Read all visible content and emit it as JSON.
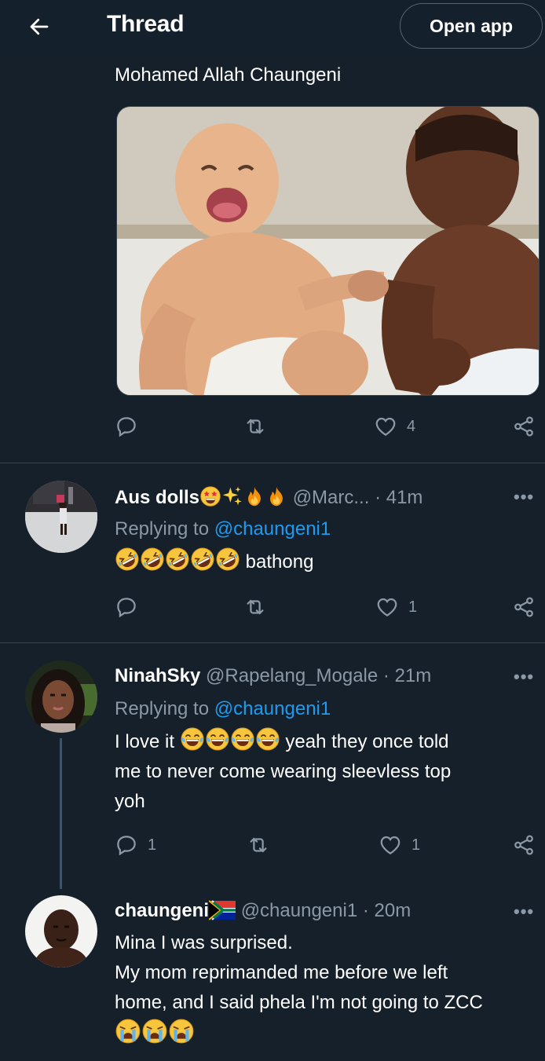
{
  "header": {
    "title": "Thread",
    "open_app_label": "Open app"
  },
  "main_tweet": {
    "author_display": "Mohamed Allah Chaungeni",
    "actions": {
      "reply_count": "",
      "retweet_count": "",
      "like_count": "4"
    }
  },
  "replies": [
    {
      "name": "Aus dolls",
      "handle": "@Marc...",
      "time": "· 41m",
      "replying_prefix": "Replying to",
      "replying_to": "@chaungeni1",
      "text": "bathong",
      "actions": {
        "reply_count": "",
        "retweet_count": "",
        "like_count": "1"
      }
    },
    {
      "name": "NinahSky",
      "handle": "@Rapelang_Mogale",
      "time": "· 21m",
      "replying_prefix": "Replying to",
      "replying_to": "@chaungeni1",
      "text_start": "I love it",
      "text_end": "yeah they once told",
      "text_line2": "me to never come wearing sleevless top",
      "text_line3": "yoh",
      "actions": {
        "reply_count": "1",
        "retweet_count": "",
        "like_count": "1"
      }
    },
    {
      "name": "chaungeni",
      "handle": "@chaungeni1",
      "time": "· 20m",
      "text_line1": "Mina I was surprised.",
      "text_line2": "My mom reprimanded me before we left",
      "text_line3": "home, and I said phela I'm not going to ZCC"
    }
  ],
  "more_label": "•••",
  "icons": [
    "back-arrow-icon",
    "reply-icon",
    "retweet-icon",
    "like-icon",
    "share-icon",
    "more-icon",
    "star-struck-emoji",
    "sparkles-emoji",
    "fire-emoji",
    "rofl-emoji",
    "tears-of-joy-emoji",
    "crying-emoji",
    "south-africa-flag"
  ],
  "colors": {
    "background": "#15202b",
    "muted": "#8b98a5",
    "link": "#1d9bf0",
    "divider": "#38444d"
  }
}
